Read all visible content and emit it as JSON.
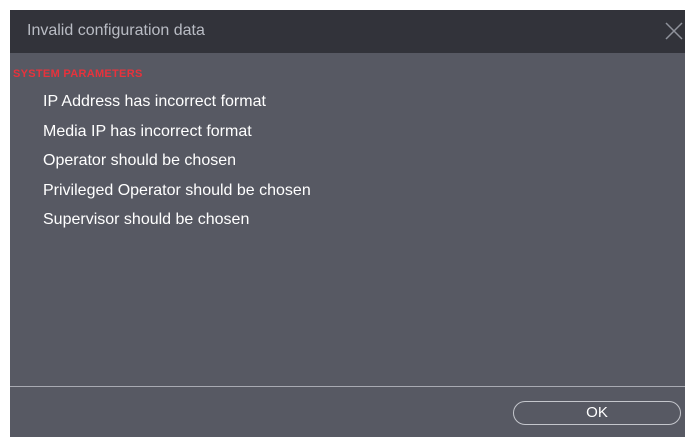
{
  "dialog": {
    "title": "Invalid configuration data",
    "close_icon": "close-icon"
  },
  "section": {
    "title": "SYSTEM PARAMETERS",
    "errors": [
      "IP Address has incorrect format",
      "Media IP has incorrect format",
      "Operator should be chosen",
      "Privileged Operator should be chosen",
      "Supervisor should be chosen"
    ]
  },
  "footer": {
    "ok_label": "OK"
  },
  "colors": {
    "titlebar": "#32333a",
    "body": "#575963",
    "section_title": "#e8323c",
    "text": "#ffffff"
  }
}
